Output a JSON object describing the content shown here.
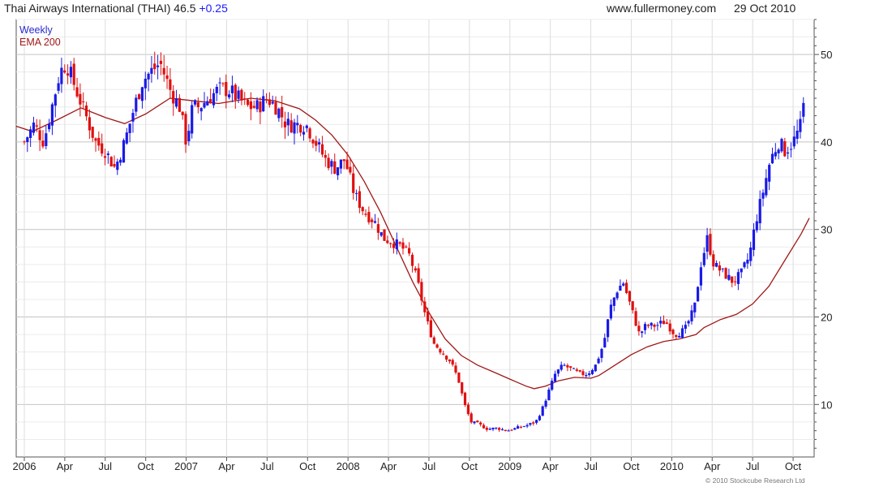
{
  "header": {
    "title": "Thai Airways International (THAI) 46.5",
    "change": "+0.25",
    "site": "www.fullermoney.com",
    "date": "29 Oct 2010"
  },
  "copyright": "© 2010 Stockcube Research Ltd",
  "colors": {
    "up": "#1a1ae6",
    "down": "#e01010",
    "ema": "#a01818",
    "grid": "#d8d8d8",
    "axis": "#555555"
  },
  "chart_data": {
    "type": "candlestick",
    "legend": [
      "Weekly",
      "EMA 200"
    ],
    "grid": true,
    "legend_position": "top-left",
    "y_axis_side": "right",
    "ylim": [
      4,
      54
    ],
    "y_ticks": [
      10,
      20,
      30,
      40,
      50
    ],
    "x_range": [
      2005.95,
      2010.88
    ],
    "x_ticks": [
      {
        "label": "2006",
        "t": 2006.0
      },
      {
        "label": "Apr",
        "t": 2006.25
      },
      {
        "label": "Jul",
        "t": 2006.5
      },
      {
        "label": "Oct",
        "t": 2006.75
      },
      {
        "label": "2007",
        "t": 2007.0
      },
      {
        "label": "Apr",
        "t": 2007.25
      },
      {
        "label": "Jul",
        "t": 2007.5
      },
      {
        "label": "Oct",
        "t": 2007.75
      },
      {
        "label": "2008",
        "t": 2008.0
      },
      {
        "label": "Apr",
        "t": 2008.25
      },
      {
        "label": "Jul",
        "t": 2008.5
      },
      {
        "label": "Oct",
        "t": 2008.75
      },
      {
        "label": "2009",
        "t": 2009.0
      },
      {
        "label": "Apr",
        "t": 2009.25
      },
      {
        "label": "Jul",
        "t": 2009.5
      },
      {
        "label": "Oct",
        "t": 2009.75
      },
      {
        "label": "2010",
        "t": 2010.0
      },
      {
        "label": "Apr",
        "t": 2010.25
      },
      {
        "label": "Jul",
        "t": 2010.5
      },
      {
        "label": "Oct",
        "t": 2010.75
      }
    ],
    "price_points": [
      [
        2006.0,
        40
      ],
      [
        2006.06,
        42
      ],
      [
        2006.12,
        40
      ],
      [
        2006.17,
        44
      ],
      [
        2006.22,
        48
      ],
      [
        2006.26,
        49
      ],
      [
        2006.32,
        46
      ],
      [
        2006.38,
        43
      ],
      [
        2006.44,
        40
      ],
      [
        2006.5,
        39
      ],
      [
        2006.56,
        37
      ],
      [
        2006.62,
        40
      ],
      [
        2006.68,
        44
      ],
      [
        2006.73,
        47
      ],
      [
        2006.78,
        48
      ],
      [
        2006.84,
        49
      ],
      [
        2006.9,
        46
      ],
      [
        2006.96,
        44
      ],
      [
        2007.0,
        40
      ],
      [
        2007.04,
        44
      ],
      [
        2007.08,
        44
      ],
      [
        2007.14,
        45
      ],
      [
        2007.2,
        46
      ],
      [
        2007.26,
        46
      ],
      [
        2007.32,
        45
      ],
      [
        2007.38,
        44
      ],
      [
        2007.44,
        44
      ],
      [
        2007.5,
        45
      ],
      [
        2007.56,
        44
      ],
      [
        2007.62,
        42
      ],
      [
        2007.68,
        42
      ],
      [
        2007.74,
        42
      ],
      [
        2007.8,
        40
      ],
      [
        2007.86,
        38
      ],
      [
        2007.92,
        37
      ],
      [
        2007.98,
        38
      ],
      [
        2008.04,
        34
      ],
      [
        2008.1,
        32
      ],
      [
        2008.16,
        31
      ],
      [
        2008.22,
        29
      ],
      [
        2008.28,
        28.5
      ],
      [
        2008.33,
        28
      ],
      [
        2008.38,
        27
      ],
      [
        2008.43,
        24
      ],
      [
        2008.48,
        20
      ],
      [
        2008.53,
        17
      ],
      [
        2008.58,
        16
      ],
      [
        2008.63,
        15
      ],
      [
        2008.68,
        13
      ],
      [
        2008.72,
        10
      ],
      [
        2008.76,
        8
      ],
      [
        2008.8,
        7.8
      ],
      [
        2008.86,
        7.2
      ],
      [
        2008.92,
        7.3
      ],
      [
        2008.98,
        7.0
      ],
      [
        2009.04,
        7.3
      ],
      [
        2009.1,
        7.6
      ],
      [
        2009.16,
        8.0
      ],
      [
        2009.2,
        9.5
      ],
      [
        2009.24,
        11.5
      ],
      [
        2009.28,
        13.5
      ],
      [
        2009.33,
        14.5
      ],
      [
        2009.38,
        14.0
      ],
      [
        2009.43,
        13.5
      ],
      [
        2009.48,
        13.5
      ],
      [
        2009.53,
        14.5
      ],
      [
        2009.58,
        17
      ],
      [
        2009.62,
        21
      ],
      [
        2009.66,
        23
      ],
      [
        2009.7,
        24
      ],
      [
        2009.75,
        21
      ],
      [
        2009.8,
        18
      ],
      [
        2009.84,
        19
      ],
      [
        2009.9,
        19
      ],
      [
        2009.96,
        19.5
      ],
      [
        2010.02,
        18
      ],
      [
        2010.08,
        18.5
      ],
      [
        2010.14,
        21
      ],
      [
        2010.18,
        26
      ],
      [
        2010.22,
        29
      ],
      [
        2010.26,
        26
      ],
      [
        2010.32,
        25
      ],
      [
        2010.38,
        24
      ],
      [
        2010.43,
        25
      ],
      [
        2010.48,
        27
      ],
      [
        2010.52,
        31
      ],
      [
        2010.56,
        34
      ],
      [
        2010.61,
        38
      ],
      [
        2010.66,
        40
      ],
      [
        2010.7,
        39
      ],
      [
        2010.75,
        40
      ],
      [
        2010.8,
        42
      ],
      [
        2010.83,
        46.5
      ]
    ],
    "ema_points": [
      [
        2005.95,
        41.8
      ],
      [
        2006.05,
        41.2
      ],
      [
        2006.2,
        42.5
      ],
      [
        2006.35,
        43.9
      ],
      [
        2006.5,
        42.8
      ],
      [
        2006.62,
        42.1
      ],
      [
        2006.75,
        43.2
      ],
      [
        2006.9,
        45.0
      ],
      [
        2007.0,
        44.8
      ],
      [
        2007.2,
        44.4
      ],
      [
        2007.4,
        45.0
      ],
      [
        2007.55,
        44.7
      ],
      [
        2007.7,
        43.8
      ],
      [
        2007.8,
        42.5
      ],
      [
        2007.9,
        40.8
      ],
      [
        2008.0,
        38.5
      ],
      [
        2008.1,
        35.5
      ],
      [
        2008.2,
        32.0
      ],
      [
        2008.3,
        28.0
      ],
      [
        2008.4,
        24.0
      ],
      [
        2008.5,
        20.5
      ],
      [
        2008.6,
        17.5
      ],
      [
        2008.7,
        15.6
      ],
      [
        2008.8,
        14.5
      ],
      [
        2008.9,
        13.7
      ],
      [
        2009.0,
        12.9
      ],
      [
        2009.1,
        12.1
      ],
      [
        2009.15,
        11.8
      ],
      [
        2009.22,
        12.1
      ],
      [
        2009.3,
        12.7
      ],
      [
        2009.4,
        13.1
      ],
      [
        2009.5,
        13.0
      ],
      [
        2009.55,
        13.3
      ],
      [
        2009.65,
        14.5
      ],
      [
        2009.75,
        15.7
      ],
      [
        2009.85,
        16.6
      ],
      [
        2009.95,
        17.2
      ],
      [
        2010.05,
        17.5
      ],
      [
        2010.15,
        18.0
      ],
      [
        2010.2,
        18.8
      ],
      [
        2010.3,
        19.7
      ],
      [
        2010.4,
        20.3
      ],
      [
        2010.5,
        21.5
      ],
      [
        2010.6,
        23.5
      ],
      [
        2010.7,
        26.5
      ],
      [
        2010.8,
        29.5
      ],
      [
        2010.85,
        31.3
      ]
    ]
  }
}
